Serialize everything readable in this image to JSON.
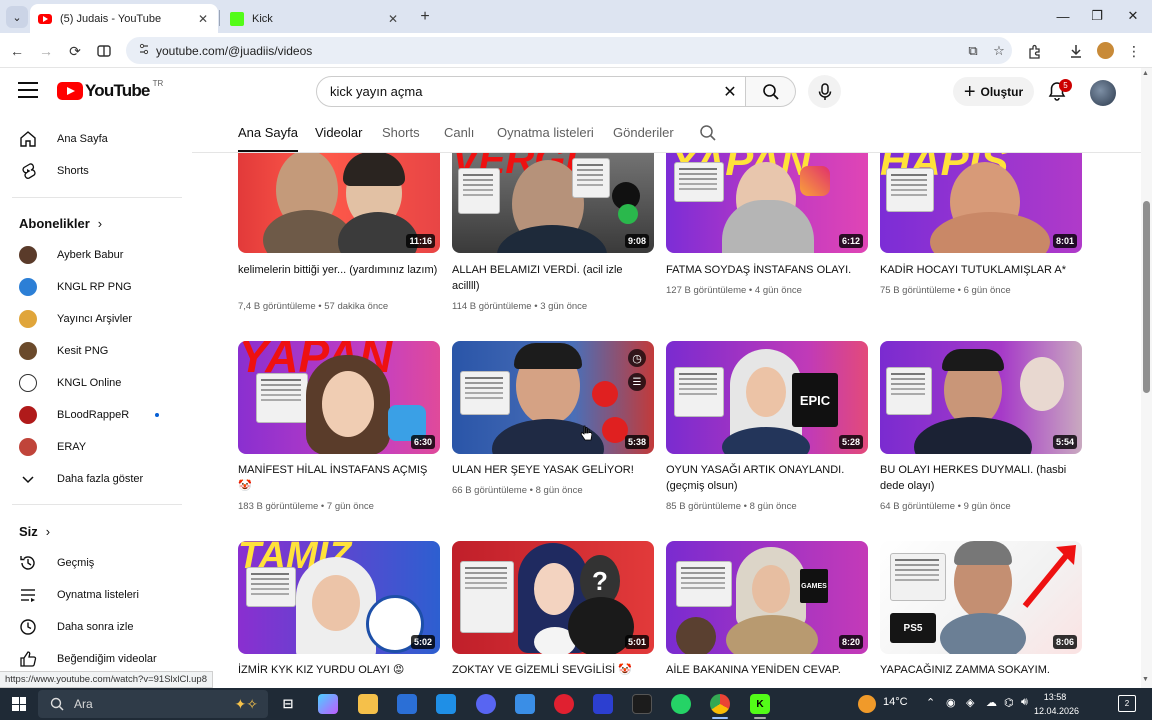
{
  "browser": {
    "tabs": [
      {
        "label": "(5) Judais - YouTube",
        "active": true
      },
      {
        "label": "Kick",
        "active": false
      }
    ],
    "url": "youtube.com/@juadiis/videos",
    "status_url": "https://www.youtube.com/watch?v=91SlxlCl.up8"
  },
  "header": {
    "logo_text": "YouTube",
    "logo_region": "TR",
    "search_value": "kick yayın açma",
    "create_label": "Oluştur",
    "notification_count": "5"
  },
  "sidebar": {
    "primary": [
      {
        "label": "Ana Sayfa",
        "icon": "home-icon"
      },
      {
        "label": "Shorts",
        "icon": "shorts-icon"
      }
    ],
    "subscriptions_title": "Abonelikler",
    "subscriptions": [
      {
        "label": "Ayberk Babur",
        "color": "#5a3b2a",
        "live": false
      },
      {
        "label": "KNGL RP PNG",
        "color": "#2c7fd6",
        "live": false
      },
      {
        "label": "Yayıncı Arşivler",
        "color": "#e0a53a",
        "live": false
      },
      {
        "label": "Kesit PNG",
        "color": "#6b4a2b",
        "live": false
      },
      {
        "label": "KNGL Online",
        "color": "#ffffff",
        "live": false
      },
      {
        "label": "BLoodRappeR",
        "color": "#b01a1a",
        "live": true
      },
      {
        "label": "ERAY",
        "color": "#c0443a",
        "live": false
      }
    ],
    "show_more": "Daha fazla göster",
    "you_title": "Siz",
    "you_items": [
      {
        "label": "Geçmiş",
        "icon": "history-icon"
      },
      {
        "label": "Oynatma listeleri",
        "icon": "playlists-icon"
      },
      {
        "label": "Daha sonra izle",
        "icon": "watch-later-icon"
      },
      {
        "label": "Beğendiğim videolar",
        "icon": "liked-icon"
      }
    ]
  },
  "channel_tabs": [
    "Ana Sayfa",
    "Videolar",
    "Shorts",
    "Canlı",
    "Oynatma listeleri",
    "Gönderiler"
  ],
  "videos": [
    {
      "title": "kelimelerin bittiği yer... (yardımınız lazım)",
      "views": "7,4 B görüntüleme",
      "age": "57 dakika önce",
      "duration": "11:16"
    },
    {
      "title": "ALLAH BELAMIZI VERDİ. (acil izle acillll)",
      "views": "114 B görüntüleme",
      "age": "3 gün önce",
      "duration": "9:08"
    },
    {
      "title": "FATMA SOYDAŞ İNSTAFANS OLAYI.",
      "views": "127 B görüntüleme",
      "age": "4 gün önce",
      "duration": "6:12"
    },
    {
      "title": "KADİR HOCAYI TUTUKLAMIŞLAR A*",
      "views": "75 B görüntüleme",
      "age": "6 gün önce",
      "duration": "8:01"
    },
    {
      "title": "MANİFEST HİLAL İNSTAFANS AÇMIŞ 🤡",
      "views": "183 B görüntüleme",
      "age": "7 gün önce",
      "duration": "6:30"
    },
    {
      "title": "ULAN HER ŞEYE YASAK GELİYOR!",
      "views": "66 B görüntüleme",
      "age": "8 gün önce",
      "duration": "5:38"
    },
    {
      "title": "OYUN YASAĞI ARTIK ONAYLANDI. (geçmiş olsun)",
      "views": "85 B görüntüleme",
      "age": "8 gün önce",
      "duration": "5:28"
    },
    {
      "title": "BU OLAYI HERKES DUYMALI. (hasbi dede olayı)",
      "views": "64 B görüntüleme",
      "age": "9 gün önce",
      "duration": "5:54"
    },
    {
      "title": "İZMİR KYK KIZ YURDU OLAYI 😡",
      "views": "",
      "age": "",
      "duration": "5:02"
    },
    {
      "title": "ZOKTAY VE GİZEMLİ SEVGİLİSİ 🤡",
      "views": "",
      "age": "",
      "duration": "5:01"
    },
    {
      "title": "AİLE BAKANINA YENİDEN CEVAP.",
      "views": "",
      "age": "",
      "duration": "8:20"
    },
    {
      "title": "YAPACAĞINIZ ZAMMA SOKAYIM.",
      "views": "",
      "age": "",
      "duration": "8:06"
    }
  ],
  "thumb_text": {
    "t2": "VERGİ",
    "t3": "YAPAN",
    "t4": "HAPİS",
    "t5": "YAPAN",
    "t9": "TAMIZ",
    "epic": "EPIC",
    "games": "GAMES",
    "ps5": "PS5"
  },
  "taskbar": {
    "search_placeholder": "Ara",
    "weather": "14°C",
    "time": "13:58",
    "date": "12.04.2026",
    "notif_count": "2"
  },
  "colors": {
    "yt_red": "#ff0000",
    "kick_green": "#53fc18",
    "taskbar": "#1f2a36"
  }
}
